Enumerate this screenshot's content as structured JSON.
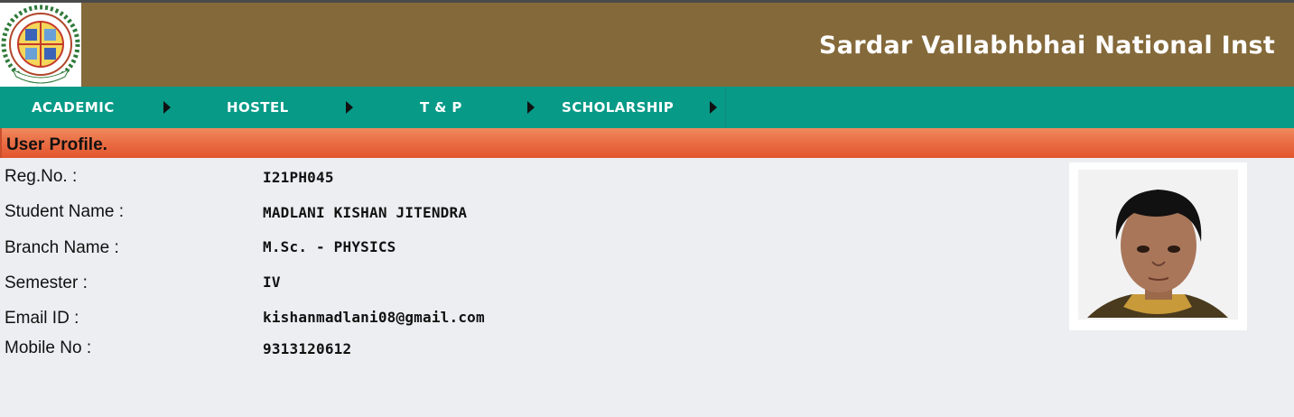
{
  "header": {
    "logo_icon": "institute-seal-logo-icon",
    "title": "Sardar Vallabhbhai National Inst"
  },
  "nav": {
    "items": [
      {
        "label": "ACADEMIC",
        "icon": "caret-right-icon"
      },
      {
        "label": "HOSTEL",
        "icon": "caret-right-icon"
      },
      {
        "label": "T & P",
        "icon": "caret-right-icon"
      },
      {
        "label": "SCHOLARSHIP",
        "icon": "caret-right-icon"
      }
    ]
  },
  "profile": {
    "section_title": "User Profile.",
    "fields": [
      {
        "label": "Reg.No. :",
        "value": "I21PH045"
      },
      {
        "label": "Student Name :",
        "value": "MADLANI KISHAN JITENDRA"
      },
      {
        "label": "Branch Name :",
        "value": "M.Sc. - PHYSICS"
      },
      {
        "label": "Semester :",
        "value": "IV"
      },
      {
        "label": "Email ID :",
        "value": "kishanmadlani08@gmail.com"
      },
      {
        "label": "Mobile No :",
        "value": "9313120612"
      }
    ],
    "photo_icon": "student-photo"
  },
  "colors": {
    "header_bg": "#84693a",
    "nav_bg": "#069a87",
    "profile_bar": "#e96a40",
    "page_bg": "#eceef2"
  }
}
